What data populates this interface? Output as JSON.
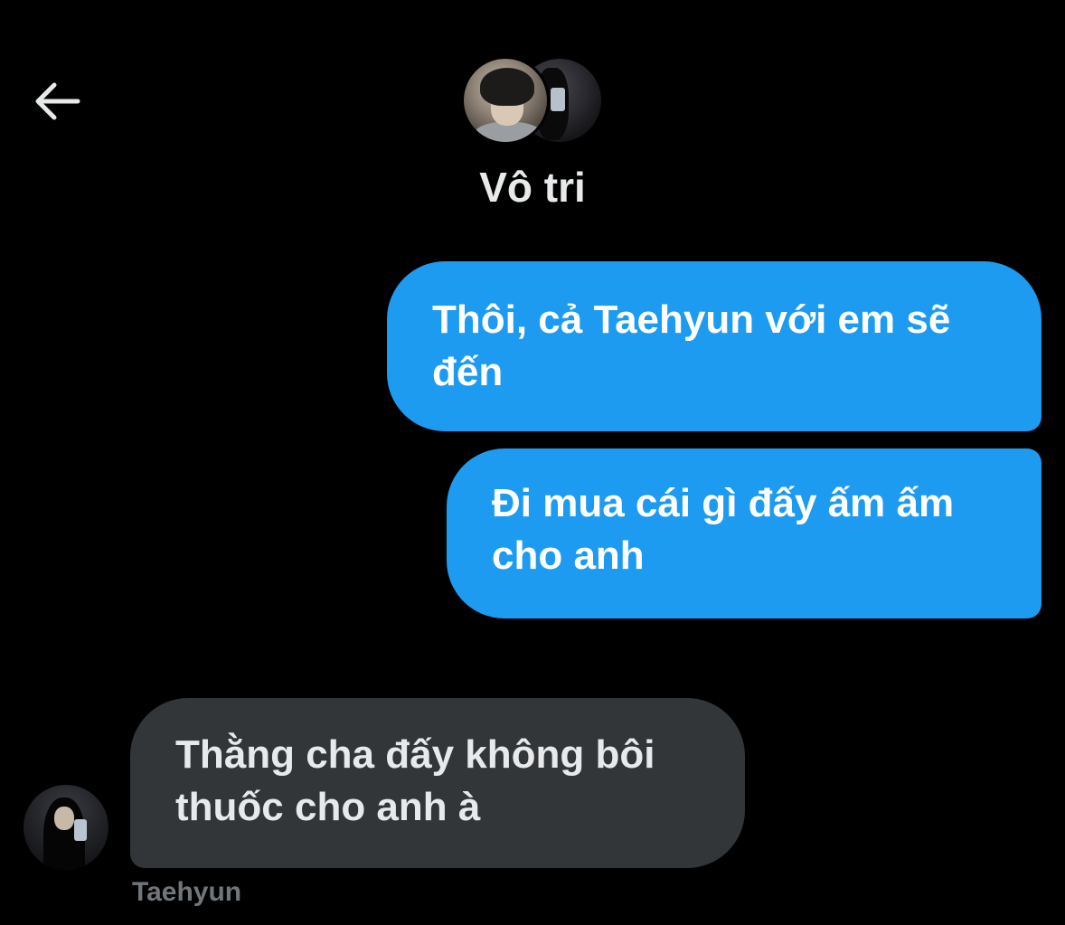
{
  "header": {
    "back_icon": "arrow-left-icon",
    "title": "Vô tri"
  },
  "messages": [
    {
      "direction": "outgoing",
      "text": "Thôi, cả Taehyun với em sẽ đến"
    },
    {
      "direction": "outgoing",
      "text": "Đi mua cái gì đấy ấm ấm cho anh"
    },
    {
      "direction": "incoming",
      "text": "Thằng cha đấy không bôi thuốc cho anh à",
      "sender": "Taehyun"
    }
  ],
  "colors": {
    "background": "#000000",
    "outgoing_bubble": "#1d9bf0",
    "incoming_bubble": "#333639",
    "primary_text": "#e7e9ea",
    "secondary_text": "#71767b"
  }
}
